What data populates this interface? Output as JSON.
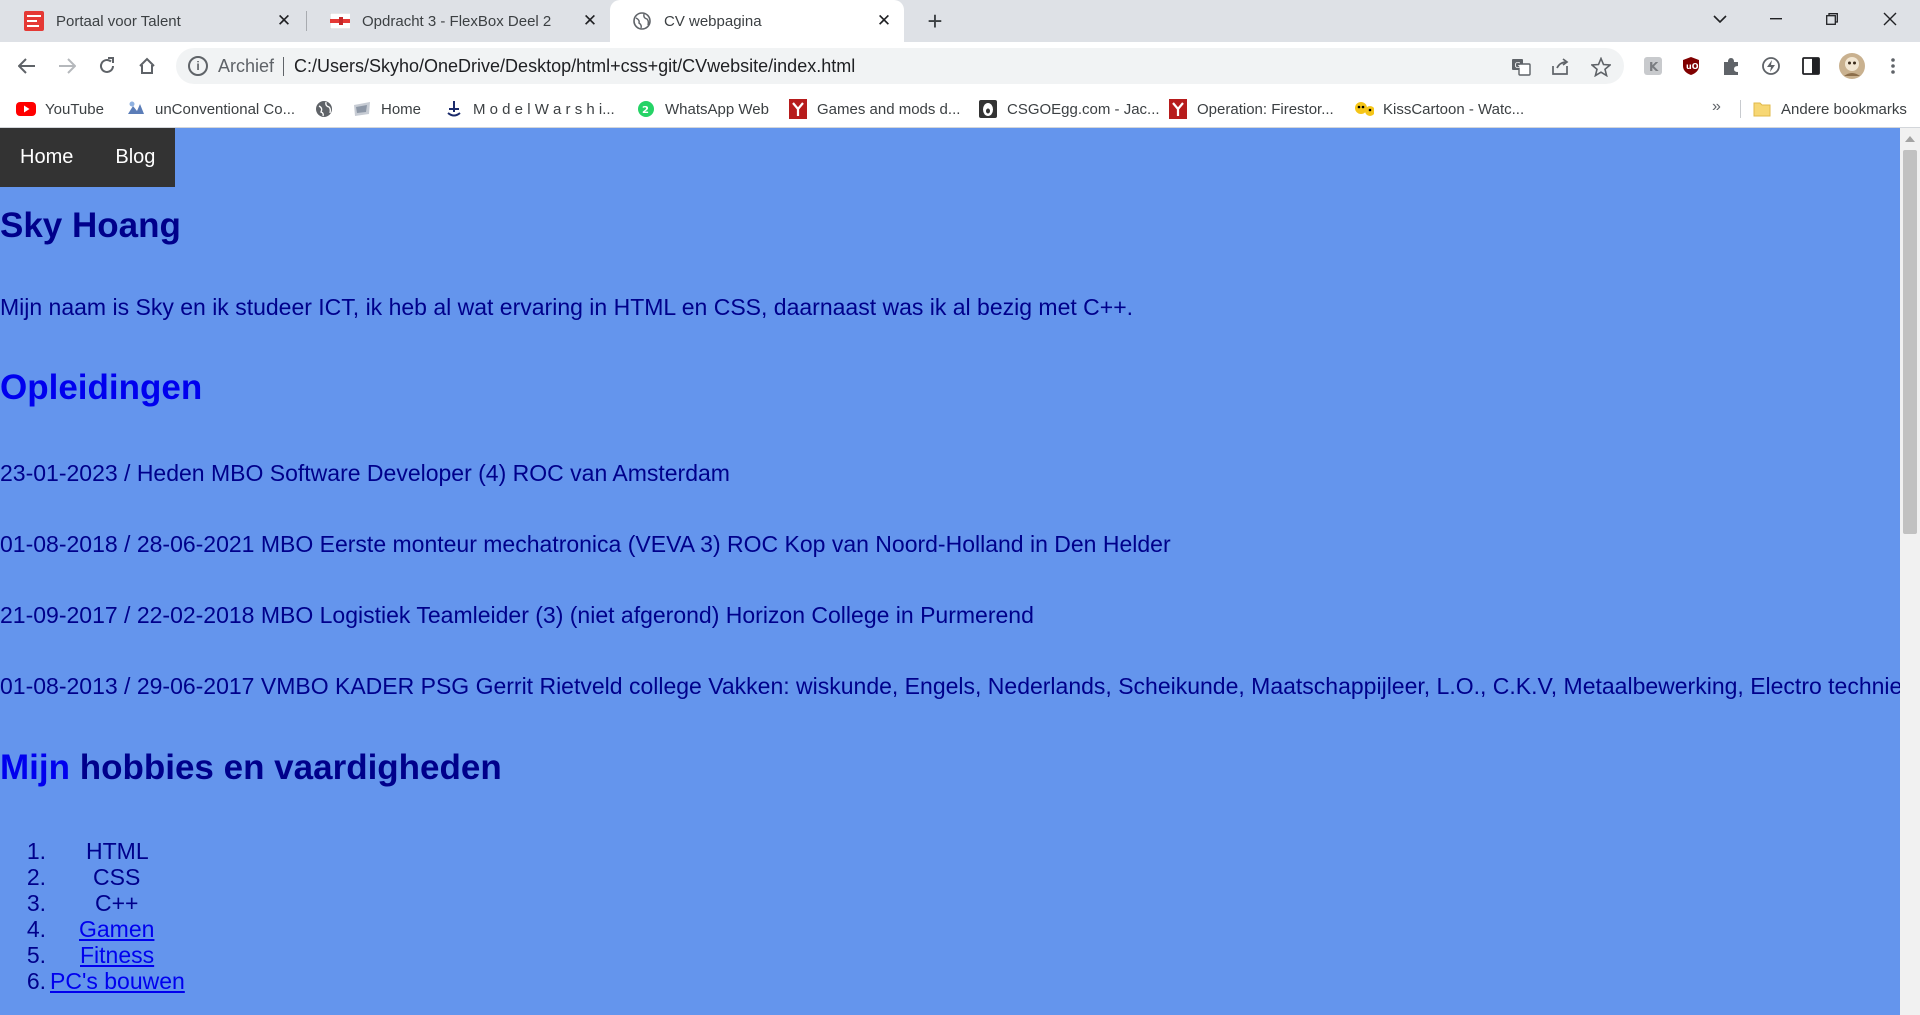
{
  "browser": {
    "tabs": [
      {
        "title": "Portaal voor Talent",
        "favicon_icon": "portaal-voor-talent-icon",
        "active": false
      },
      {
        "title": "Opdracht 3 - FlexBox Deel 2",
        "favicon_icon": "flag-icon",
        "active": false
      },
      {
        "title": "CV webpagina",
        "favicon_icon": "globe-icon",
        "active": true
      }
    ],
    "address": {
      "chip": "Archief",
      "url": "C:/Users/Skyho/OneDrive/Desktop/html+css+git/CVwebsite/index.html"
    },
    "bookmarks": [
      {
        "label": "YouTube",
        "icon": "youtube-icon"
      },
      {
        "label": "unConventional Co...",
        "icon": "unconventional-icon"
      },
      {
        "label": "",
        "icon": "globe-icon"
      },
      {
        "label": "Home",
        "icon": "home-bookmark-icon"
      },
      {
        "label": "M o d e l W a r s h i...",
        "icon": "modelwarship-icon"
      },
      {
        "label": "WhatsApp Web",
        "icon": "whatsapp-icon"
      },
      {
        "label": "Games and mods d...",
        "icon": "games-mods-icon"
      },
      {
        "label": "CSGOEgg.com - Jac...",
        "icon": "csgoegg-icon"
      },
      {
        "label": "Operation: Firestor...",
        "icon": "firestorm-icon"
      },
      {
        "label": "KissCartoon - Watc...",
        "icon": "kisscartoon-icon"
      }
    ],
    "more_bookmarks": "»",
    "other_bookmarks": "Andere bookmarks"
  },
  "page": {
    "background_color": "#6495ed",
    "text_color": "#00008b",
    "link_color": "#0000ee",
    "nav": [
      {
        "label": "Home"
      },
      {
        "label": "Blog"
      }
    ],
    "name_heading": "Sky Hoang",
    "intro": "Mijn naam is Sky en ik studeer ICT, ik heb al wat ervaring in HTML en CSS, daarnaast was ik al bezig met C++.",
    "education_heading": "Opleidingen",
    "education": [
      "23-01-2023 / Heden MBO Software Developer (4) ROC van Amsterdam",
      "01-08-2018 / 28-06-2021 MBO Eerste monteur mechatronica (VEVA 3) ROC Kop van Noord-Holland in Den Helder",
      "21-09-2017 / 22-02-2018 MBO Logistiek Teamleider (3) (niet afgerond) Horizon College in Purmerend",
      "01-08-2013 / 29-06-2017 VMBO KADER PSG Gerrit Rietveld college Vakken: wiskunde, Engels, Nederlands, Scheikunde, Maatschappijleer, L.O., C.K.V, Metaalbewerking, Electro techniek"
    ],
    "hobbies_heading_link": "Mijn",
    "hobbies_heading_rest": " hobbies en vaardigheden",
    "hobbies": [
      {
        "num": "1.",
        "label": "HTML",
        "link": false
      },
      {
        "num": "2.",
        "label": "CSS",
        "link": false
      },
      {
        "num": "3.",
        "label": "C++",
        "link": false
      },
      {
        "num": "4.",
        "label": "Gamen",
        "link": true
      },
      {
        "num": "5.",
        "label": "Fitness",
        "link": true
      },
      {
        "num": "6.",
        "label": "PC's bouwen",
        "link": true
      }
    ]
  }
}
